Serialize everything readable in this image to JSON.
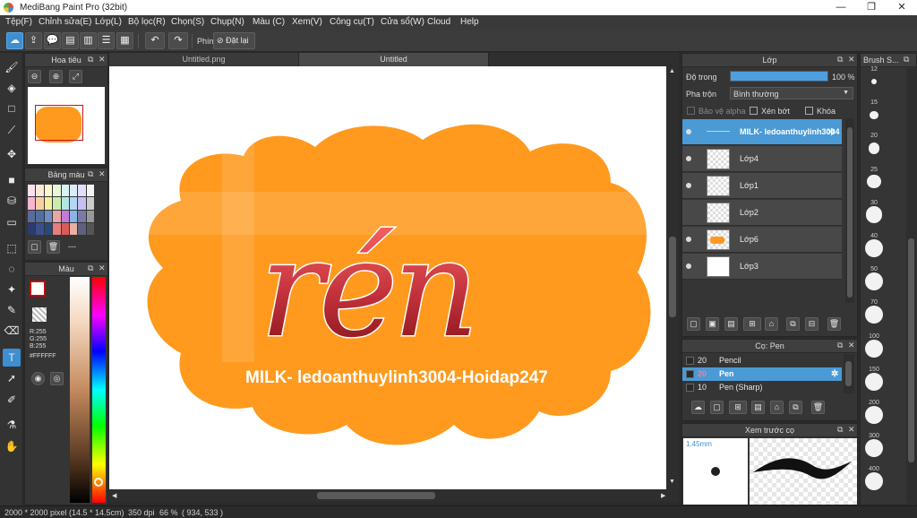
{
  "window": {
    "title": "MediBang Paint Pro (32bit)",
    "minimize": "—",
    "maximize": "❐",
    "close": "✕"
  },
  "menu": [
    "Tệp(F)",
    "Chỉnh sửa(E)",
    "Lớp(L)",
    "Bộ lọc(R)",
    "Chọn(S)",
    "Chụp(N)",
    "Màu (C)",
    "Xem(V)",
    "Công cụ(T)",
    "Cửa sổ(W)",
    "Cloud",
    "Help"
  ],
  "toolbar": {
    "shortcut_label": "Phím",
    "reset_label": "Đặt lại"
  },
  "navigator": {
    "title": "Hoa tiêu"
  },
  "palette": {
    "title": "Bảng màu",
    "dash": "---"
  },
  "color_panel": {
    "title": "Màu",
    "r": "R:255",
    "g": "G:255",
    "b": "B:255",
    "hex": "#FFFFFF"
  },
  "tabs": [
    "Untitled.png",
    "Untitled"
  ],
  "canvas": {
    "title_text": "rén",
    "caption": "MILK- ledoanthuylinh3004-Hoidap247",
    "accent": "#ff9a1f"
  },
  "layers_panel": {
    "title": "Lớp",
    "opacity_label": "Độ trong",
    "opacity_value": "100 %",
    "opacity_fraction": 1.0,
    "blend_label": "Pha trộn",
    "blend_value": "Bình thường",
    "protect_alpha": "Bảo vệ alpha",
    "clipping": "Xén bớt",
    "lock": "Khóa",
    "layers": [
      {
        "name": "MILK- ledoanthuylinh3004",
        "active": true
      },
      {
        "name": "Lớp4",
        "active": false
      },
      {
        "name": "Lớp1",
        "active": false
      },
      {
        "name": "Lớp2",
        "active": false
      },
      {
        "name": "Lớp6",
        "active": false
      },
      {
        "name": "Lớp3",
        "active": false
      }
    ]
  },
  "brush_panel": {
    "title": "Cọ: Pen",
    "brushes": [
      {
        "size": "20",
        "name": "Pencil",
        "active": false
      },
      {
        "size": "20",
        "name": "Pen",
        "active": true
      },
      {
        "size": "10",
        "name": "Pen (Sharp)",
        "active": false
      }
    ]
  },
  "preview_panel": {
    "title": "Xem trước cọ",
    "size": "1.45mm"
  },
  "brush_size_panel": {
    "title": "Brush S...",
    "sizes": [
      "12",
      "15",
      "20",
      "25",
      "30",
      "40",
      "50",
      "70",
      "100",
      "150",
      "200",
      "300",
      "400"
    ]
  },
  "status": {
    "dimensions": "2000 * 2000 pixel",
    "physical": "(14.5 * 14.5cm)",
    "dpi": "350 dpi",
    "zoom": "66 %",
    "coords": "( 934, 533 )"
  }
}
